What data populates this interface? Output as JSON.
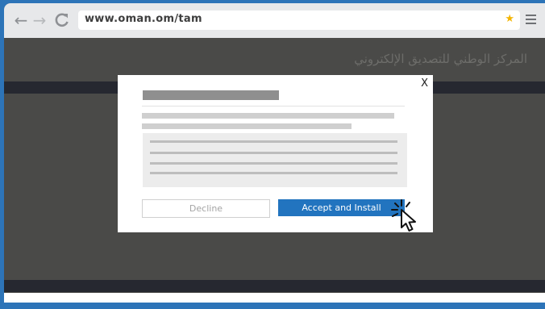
{
  "browser": {
    "url": "www.oman.om/tam",
    "nav": {
      "back_icon": "←",
      "forward_icon": "→",
      "reload_icon": "C"
    }
  },
  "page": {
    "title": "المركز الوطني للتصديق الإلكتروني"
  },
  "dialog": {
    "close_label": "X",
    "decline_label": "Decline",
    "accept_label": "Accept and Install"
  },
  "colors": {
    "accent": "#2274bf",
    "frame": "#2d74b8",
    "page_bg": "#4a4a48",
    "star": "#f4b400"
  }
}
